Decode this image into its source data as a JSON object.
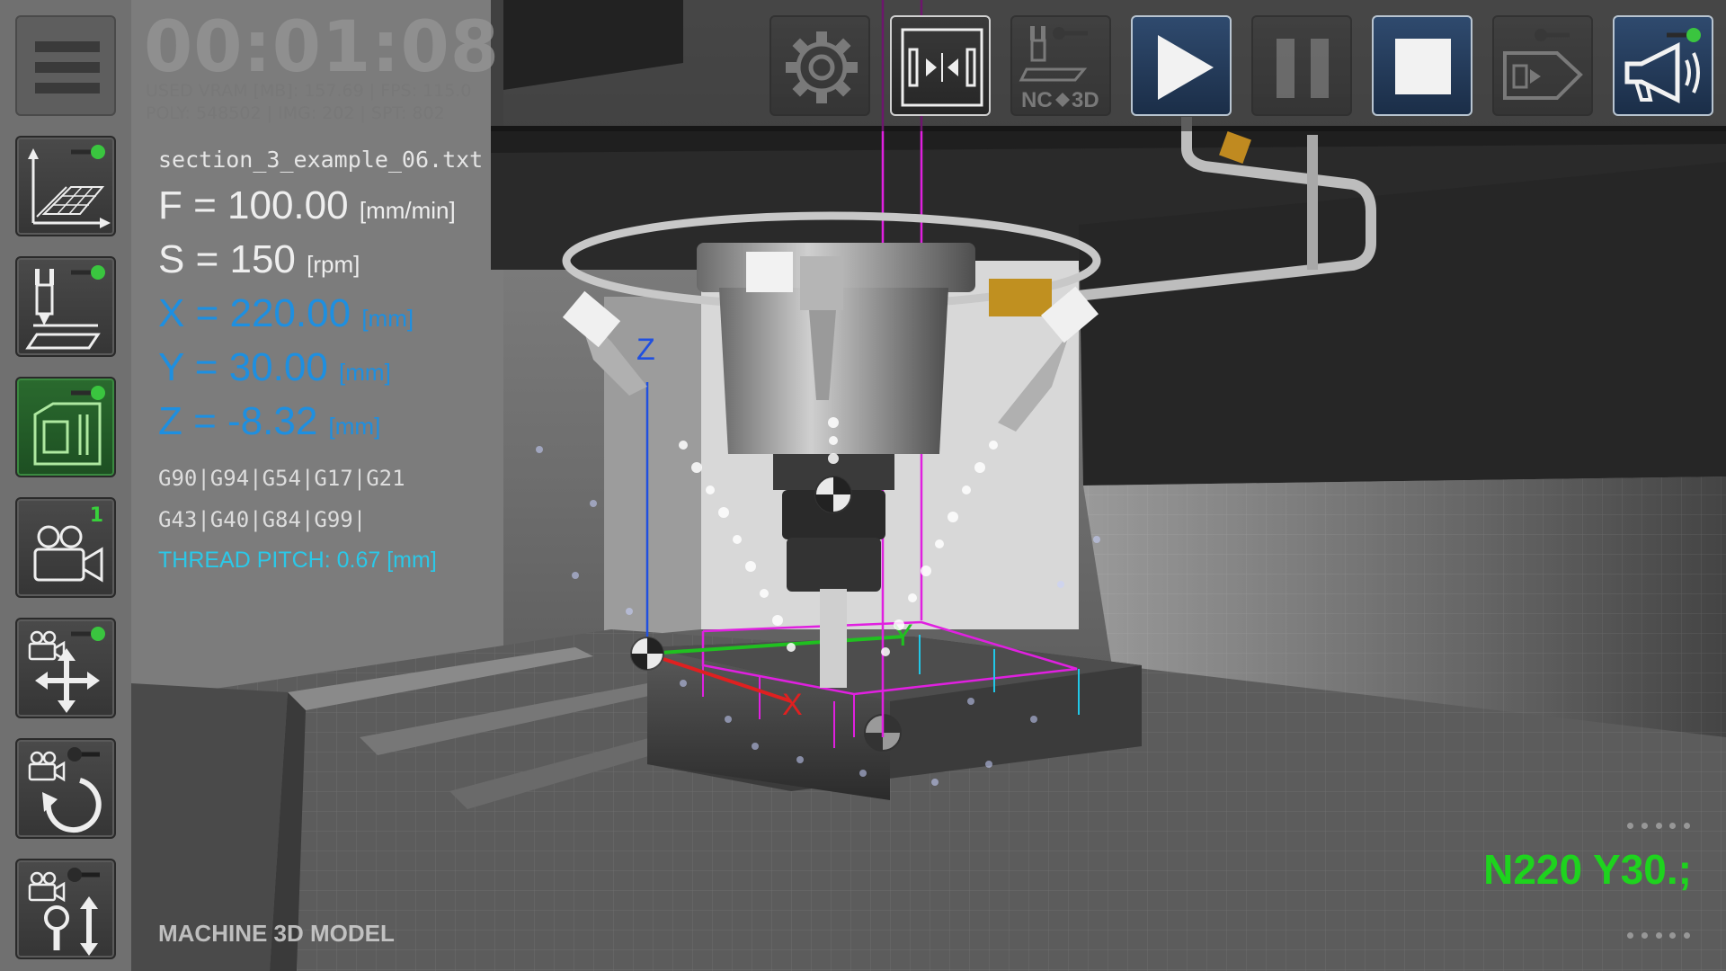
{
  "hud": {
    "timer": "00:01:08",
    "stats_line1": "USED VRAM [MB]: 157.69 | FPS: 115.0",
    "stats_line2": "POLY: 548502 | IMG: 202 | SPT: 802",
    "filename": "section_3_example_06.txt",
    "feed": {
      "label": "F = 100.00",
      "unit": "[mm/min]"
    },
    "speed": {
      "label": "S = 150",
      "unit": "[rpm]"
    },
    "x": {
      "label": "X = 220.00",
      "unit": "[mm]"
    },
    "y": {
      "label": "Y = 30.00",
      "unit": "[mm]"
    },
    "z": {
      "label": "Z = -8.32",
      "unit": "[mm]"
    },
    "gcodes_line1": "G90|G94|G54|G17|G21",
    "gcodes_line2": "G43|G40|G84|G99|",
    "thread_pitch": "THREAD PITCH: 0.67 [mm]",
    "view_label": "MACHINE 3D MODEL",
    "current_nc_line": "N220 Y30.;",
    "camera_number": "1"
  },
  "scene": {
    "axis_labels": {
      "x": "X",
      "y": "Y",
      "z": "Z"
    },
    "axis_colors": {
      "x": "#e02020",
      "y": "#20c020",
      "z": "#2050e0"
    }
  },
  "left_toolbar": [
    {
      "name": "menu-button",
      "icon": "hamburger-icon"
    },
    {
      "name": "toolpath-grid-toggle",
      "icon": "axes-grid-icon",
      "indicator": "on"
    },
    {
      "name": "tool-path-toggle",
      "icon": "tool-plane-icon",
      "indicator": "on"
    },
    {
      "name": "machine-model-toggle",
      "icon": "machine-icon",
      "indicator": "on",
      "active": true
    },
    {
      "name": "camera-select-button",
      "icon": "video-camera-icon"
    },
    {
      "name": "camera-pan-button",
      "icon": "camera-move-icon",
      "indicator": "on"
    },
    {
      "name": "camera-rotate-button",
      "icon": "camera-rotate-icon",
      "indicator": "off"
    },
    {
      "name": "camera-zoom-button",
      "icon": "camera-zoom-icon",
      "indicator": "off"
    }
  ],
  "top_toolbar": [
    {
      "name": "settings-button",
      "icon": "gear-icon"
    },
    {
      "name": "split-view-button",
      "icon": "split-view-icon",
      "active": true
    },
    {
      "name": "nc-3d-button",
      "icon": "nc-3d-icon",
      "label": "NC",
      "label2": "3D"
    },
    {
      "name": "play-button",
      "icon": "play-icon",
      "active": true
    },
    {
      "name": "pause-button",
      "icon": "pause-icon"
    },
    {
      "name": "stop-button",
      "icon": "stop-icon",
      "active": true
    },
    {
      "name": "export-button",
      "icon": "export-icon"
    },
    {
      "name": "sound-button",
      "icon": "megaphone-icon",
      "active": true
    }
  ]
}
